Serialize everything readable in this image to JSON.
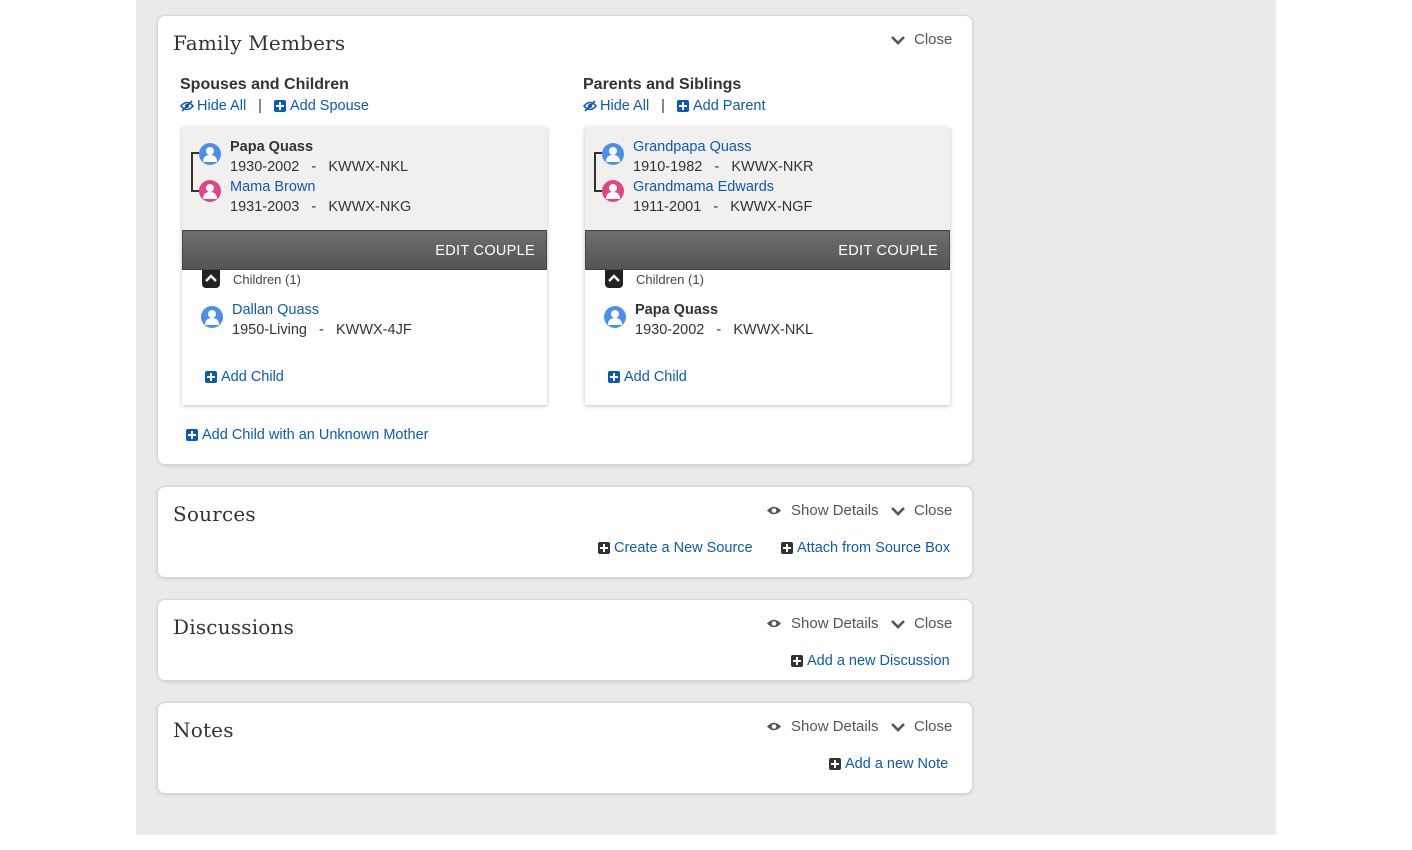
{
  "family_members": {
    "title": "Family Members",
    "close_label": "Close",
    "spouses": {
      "title": "Spouses and Children",
      "hide_all": "Hide All",
      "separator": "|",
      "add_label": "Add Spouse",
      "couple": [
        {
          "name": "Papa Quass",
          "info": "1930-2002   -   KWWX-NKL",
          "gender": "male",
          "linked": false
        },
        {
          "name": "Mama Brown",
          "info": "1931-2003   -   KWWX-NKG",
          "gender": "female",
          "linked": true
        }
      ],
      "edit_couple": "EDIT COUPLE",
      "children_label": "Children (1)",
      "child": {
        "name": "Dallan Quass",
        "info": "1950-Living   -   KWWX-4JF",
        "linked": true
      },
      "add_child": "Add Child"
    },
    "parents": {
      "title": "Parents and Siblings",
      "hide_all": "Hide All",
      "separator": "|",
      "add_label": "Add Parent",
      "couple": [
        {
          "name": "Grandpapa Quass",
          "info": "1910-1982   -   KWWX-NKR",
          "gender": "male",
          "linked": true
        },
        {
          "name": "Grandmama Edwards",
          "info": "1911-2001   -   KWWX-NGF",
          "gender": "female",
          "linked": true
        }
      ],
      "edit_couple": "EDIT COUPLE",
      "children_label": "Children (1)",
      "child": {
        "name": "Papa Quass",
        "info": "1930-2002   -   KWWX-NKL",
        "linked": false
      },
      "add_child": "Add Child"
    },
    "add_unknown_mother": "Add Child with an Unknown Mother"
  },
  "sources": {
    "title": "Sources",
    "show_details": "Show Details",
    "close_label": "Close",
    "create_new": "Create a New Source",
    "attach": "Attach from Source Box"
  },
  "discussions": {
    "title": "Discussions",
    "show_details": "Show Details",
    "close_label": "Close",
    "add": "Add a new Discussion"
  },
  "notes": {
    "title": "Notes",
    "show_details": "Show Details",
    "close_label": "Close",
    "add": "Add a new Note"
  },
  "colors": {
    "link": "#0b5ab8",
    "male_avatar": "#4a8ff0",
    "female_avatar": "#e04680",
    "edit_bar": "#5f5f5f",
    "page_background": "#ebeae8"
  }
}
